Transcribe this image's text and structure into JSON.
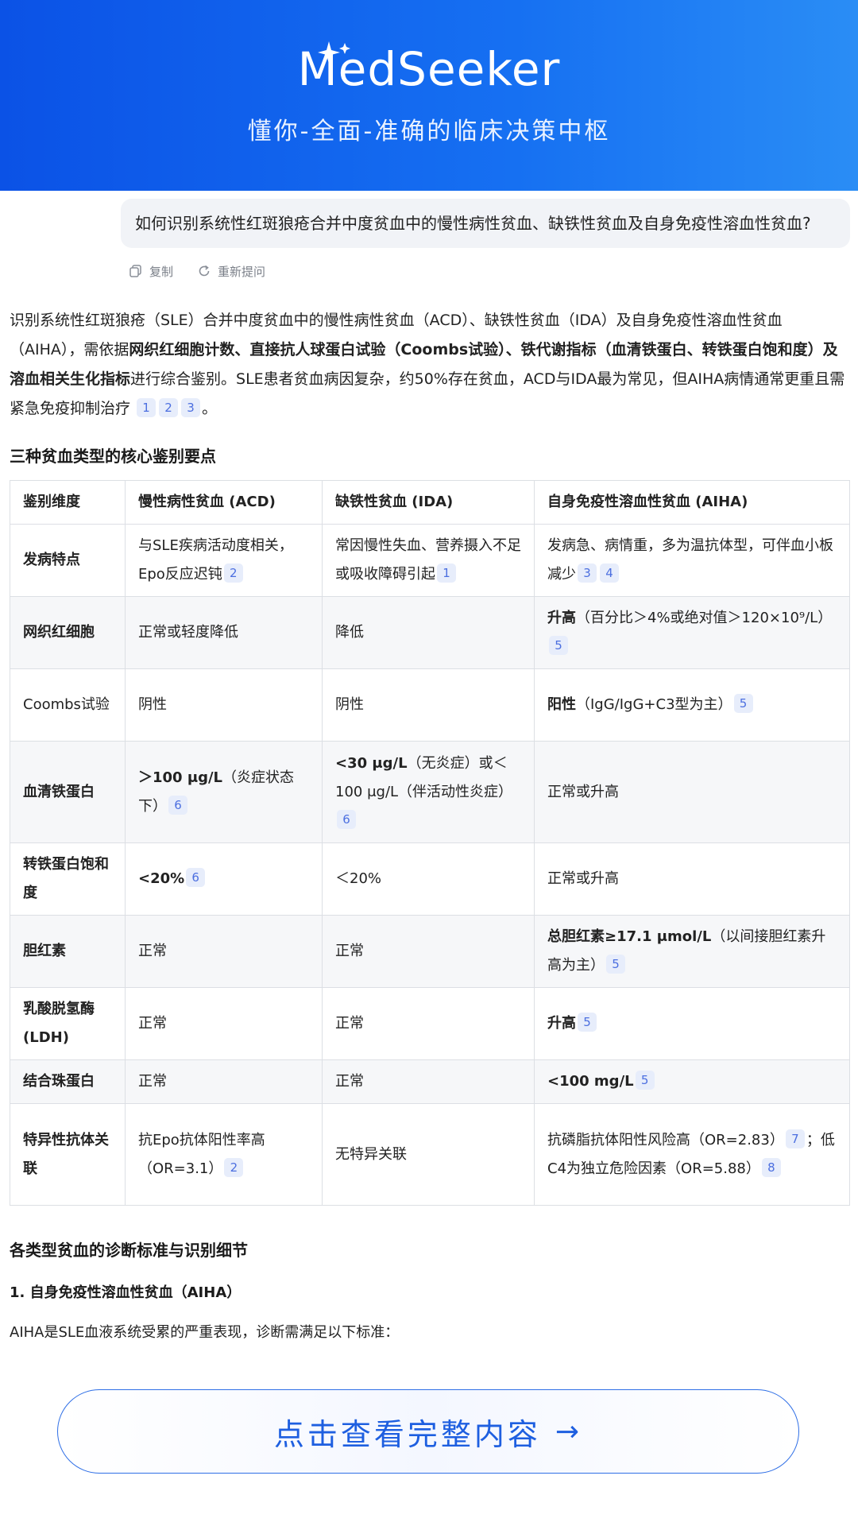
{
  "header": {
    "logo": "MedSeeker",
    "tagline": "懂你-全面-准确的临床决策中枢"
  },
  "question": {
    "text": "如何识别系统性红斑狼疮合并中度贫血中的慢性病性贫血、缺铁性贫血及自身免疫性溶血性贫血?",
    "copy_label": "复制",
    "retry_label": "重新提问"
  },
  "intro": {
    "t1": "识别系统性红斑狼疮（SLE）合并中度贫血中的慢性病性贫血（ACD）、缺铁性贫血（IDA）及自身免疫性溶血性贫血（AIHA），需依据",
    "b1": "网织红细胞计数、直接抗人球蛋白试验（Coombs试验）、铁代谢指标（血清铁蛋白、转铁蛋白饱和度）及溶血相关生化指标",
    "t2": "进行综合鉴别。SLE患者贫血病因复杂，约50%存在贫血，ACD与IDA最为常见，但AIHA病情通常更重且需紧急免疫抑制治疗",
    "cites": [
      "1",
      "2",
      "3"
    ],
    "end": "。"
  },
  "section1_title": "三种贫血类型的核心鉴别要点",
  "table": {
    "headers": [
      "鉴别维度",
      "慢性病性贫血 (ACD)",
      "缺铁性贫血 (IDA)",
      "自身免疫性溶血性贫血 (AIHA)"
    ],
    "rows": [
      {
        "dim": "发病特点",
        "acd": "与SLE疾病活动度相关，Epo反应迟钝",
        "acd_cite": "2",
        "ida": "常因慢性失血、营养摄入不足或吸收障碍引起",
        "ida_cite": "1",
        "aiha": "发病急、病情重，多为温抗体型，可伴血小板减少",
        "aiha_cites": [
          "3",
          "4"
        ]
      },
      {
        "dim": "网织红细胞",
        "acd": "正常或轻度降低",
        "ida": "降低",
        "aiha_bold": "升高",
        "aiha": "（百分比＞4%或绝对值＞120×10⁹/L）",
        "aiha_cite": "5"
      },
      {
        "dim": "Coombs试验",
        "acd": "阴性",
        "ida": "阴性",
        "aiha_bold": "阳性",
        "aiha": "（IgG/IgG+C3型为主）",
        "aiha_cite": "5"
      },
      {
        "dim": "血清铁蛋白",
        "acd_bold": "＞100 μg/L",
        "acd": "（炎症状态下）",
        "acd_cite": "6",
        "ida_bold": "<30 μg/L",
        "ida": "（无炎症）或＜100 μg/L（伴活动性炎症）",
        "ida_cite": "6",
        "aiha": "正常或升高"
      },
      {
        "dim": "转铁蛋白饱和度",
        "acd_bold": "<20%",
        "acd_cite": "6",
        "ida": "＜20%",
        "aiha": "正常或升高"
      },
      {
        "dim": "胆红素",
        "acd": "正常",
        "ida": "正常",
        "aiha_bold": "总胆红素≥17.1 μmol/L",
        "aiha": "（以间接胆红素升高为主）",
        "aiha_cite": "5"
      },
      {
        "dim": "乳酸脱氢酶(LDH)",
        "acd": "正常",
        "ida": "正常",
        "aiha_bold": "升高",
        "aiha_cite": "5"
      },
      {
        "dim": "结合珠蛋白",
        "acd": "正常",
        "ida": "正常",
        "aiha_bold": "<100 mg/L",
        "aiha_cite": "5"
      },
      {
        "dim": "特异性抗体关联",
        "acd": "抗Epo抗体阳性率高（OR=3.1）",
        "acd_cite": "2",
        "ida": "无特异关联",
        "aiha": "抗磷脂抗体阳性风险高（OR=2.83）",
        "aiha_cite": "7",
        "aiha2": "；低C4为独立危险因素（OR=5.88）",
        "aiha_cite2": "8"
      }
    ]
  },
  "section2_title": "各类型贫血的诊断标准与识别细节",
  "subsection1": "1. 自身免疫性溶血性贫血（AIHA）",
  "para1": "AIHA是SLE血液系统受累的严重表现，诊断需满足以下标准：",
  "cta": {
    "label": "点击查看完整内容",
    "arrow": "→"
  },
  "colors": {
    "brand_blue": "#1670f2",
    "cite_bg": "#e7edfb",
    "cite_text": "#4c6fe0"
  }
}
